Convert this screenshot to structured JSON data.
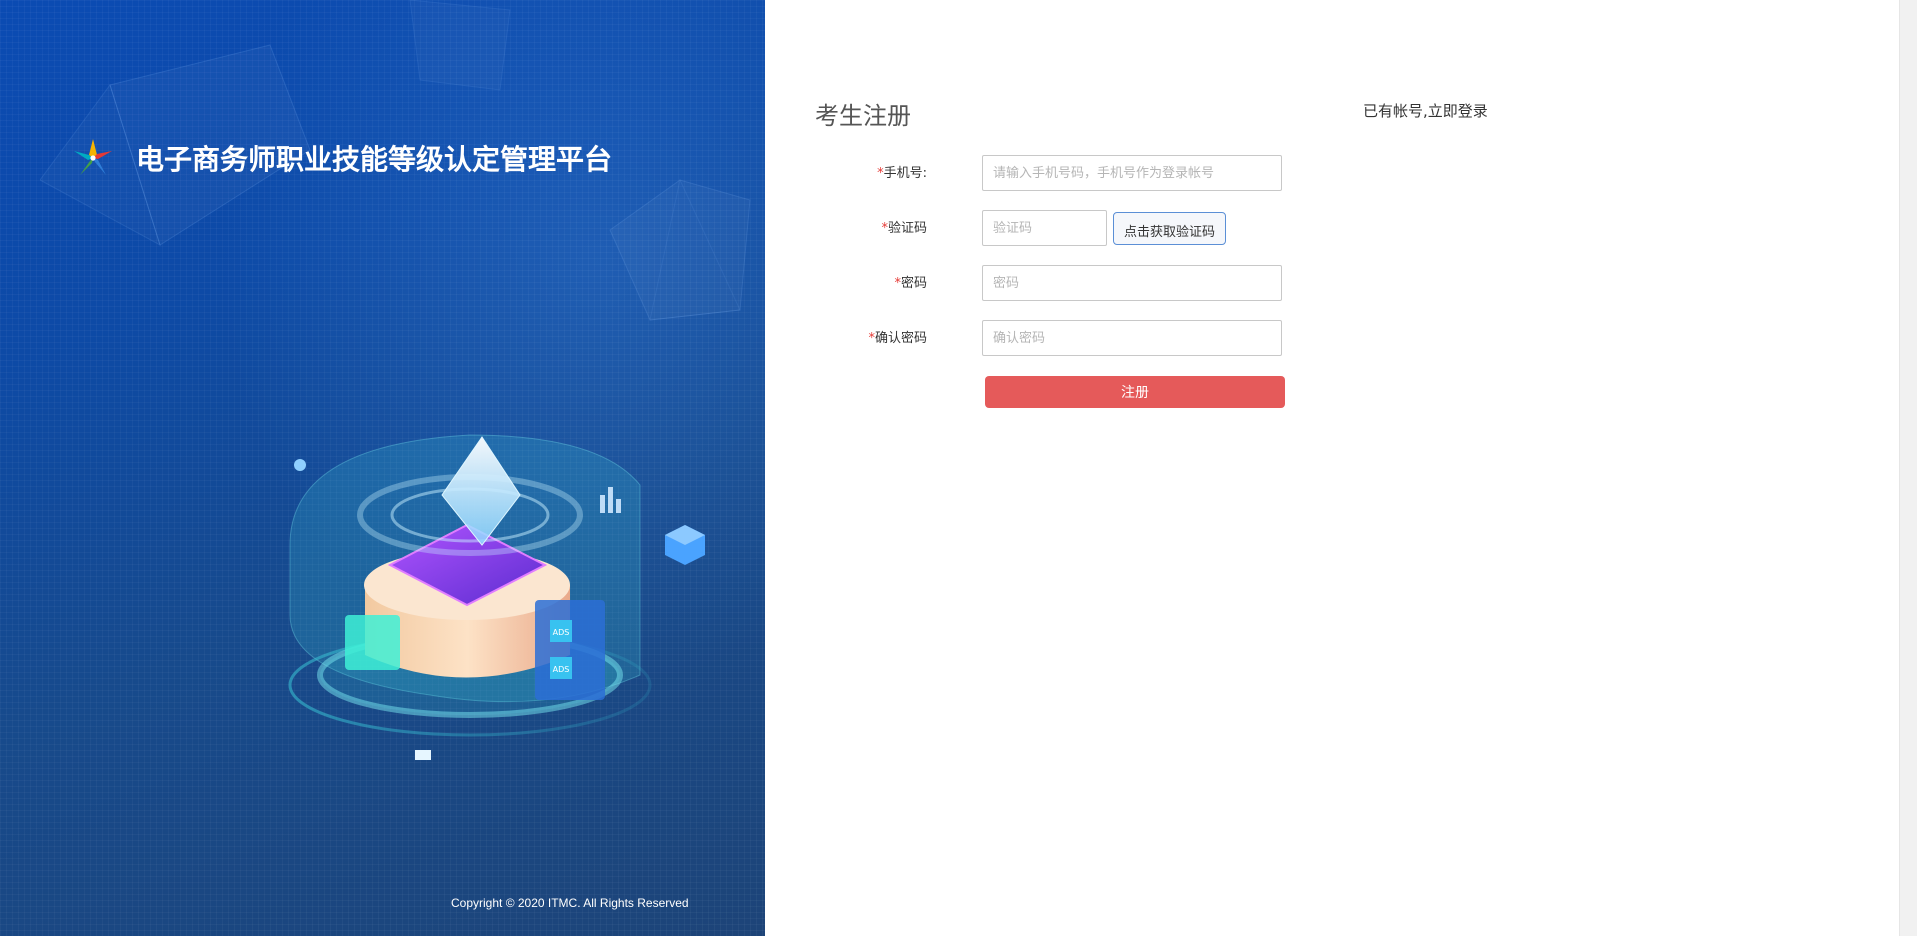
{
  "brand": {
    "title": "电子商务师职业技能等级认定管理平台",
    "logo_icon": "colorful-star-logo"
  },
  "illustration": {
    "ads_label_1": "ADS",
    "ads_label_2": "ADS"
  },
  "footer": {
    "copyright": "Copyright © 2020 ITMC. All Rights Reserved"
  },
  "form": {
    "title": "考生注册",
    "login_link": "已有帐号,立即登录",
    "required_mark": "*",
    "phone": {
      "label": "手机号:",
      "placeholder": "请输入手机号码，手机号作为登录帐号",
      "value": ""
    },
    "code": {
      "label": "验证码",
      "placeholder": "验证码",
      "value": "",
      "button_label": "点击获取验证码"
    },
    "password": {
      "label": "密码",
      "placeholder": "密码",
      "value": ""
    },
    "confirm_password": {
      "label": "确认密码",
      "placeholder": "确认密码",
      "value": ""
    },
    "submit_label": "注册"
  },
  "colors": {
    "left_bg": "#0d4aa6",
    "submit_bg": "#e55a5a",
    "required": "#e53935",
    "code_button_border": "#5b8fd6"
  }
}
